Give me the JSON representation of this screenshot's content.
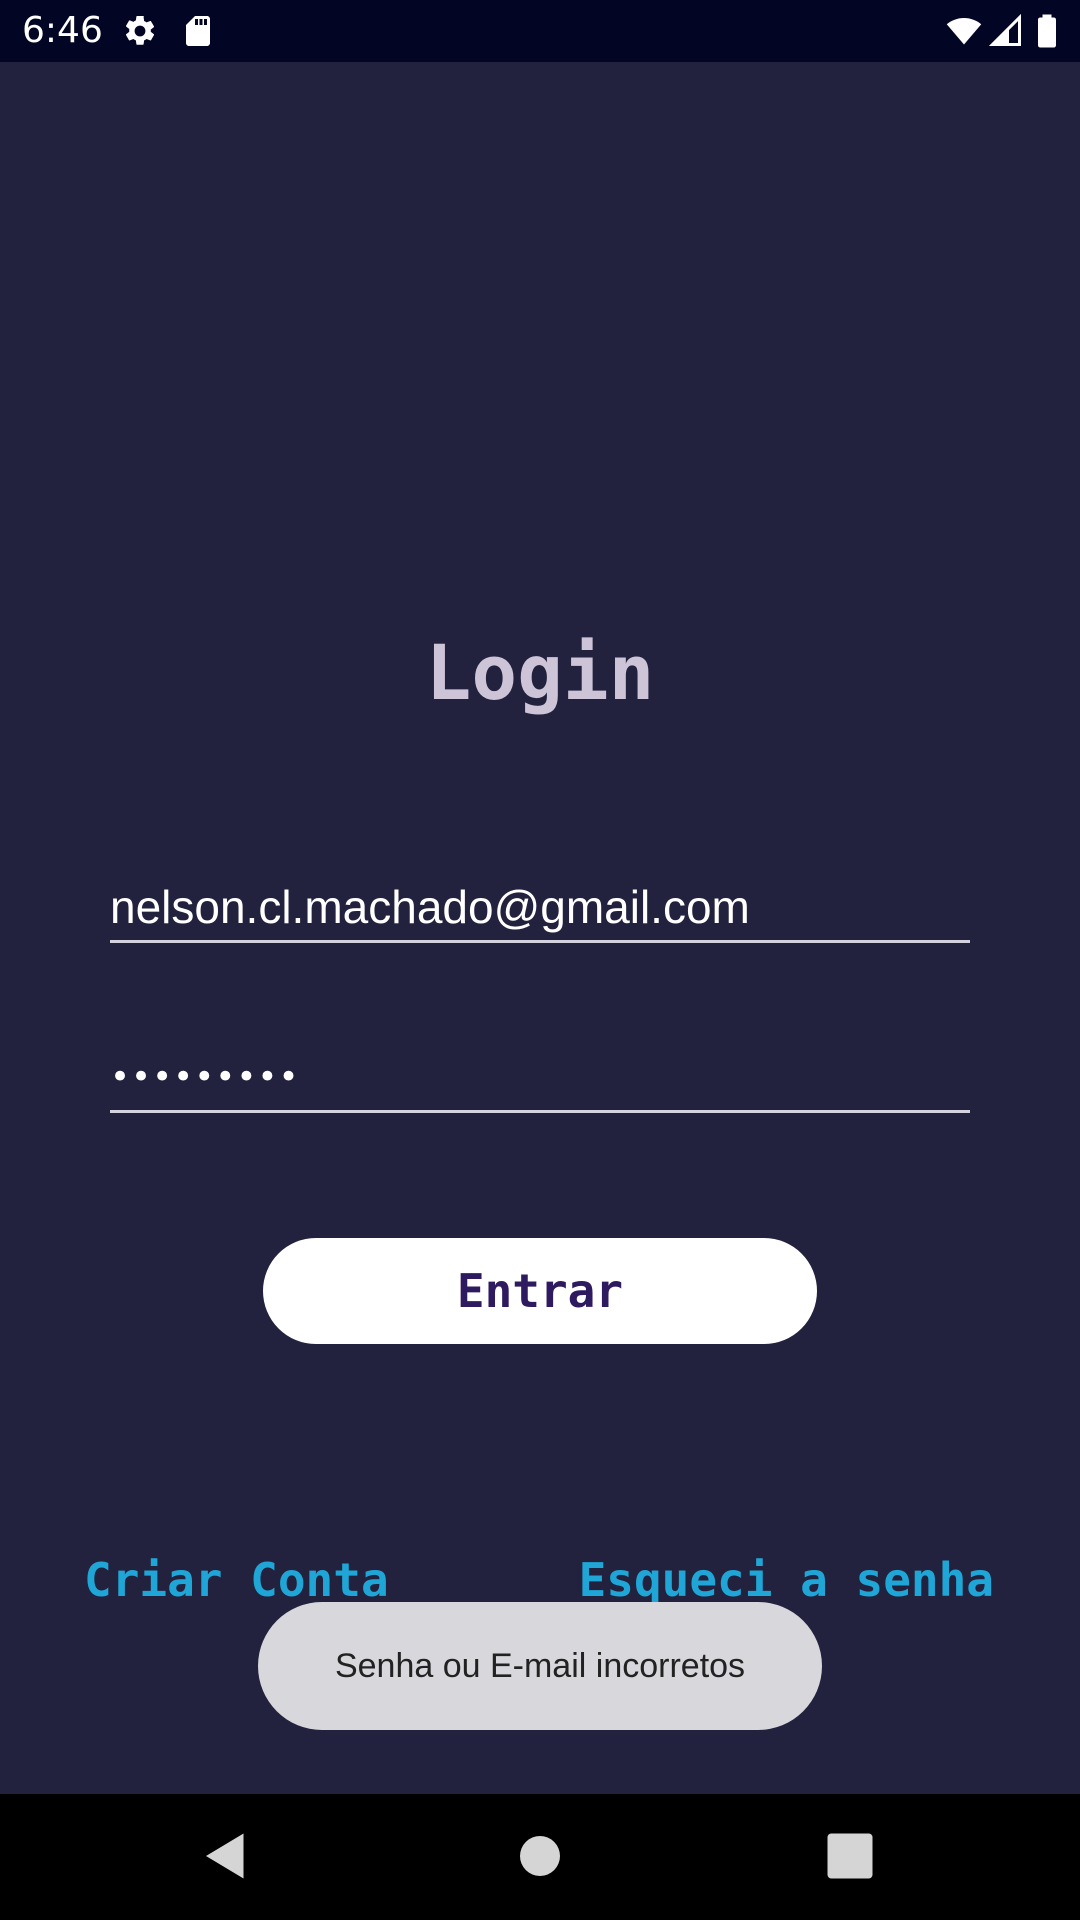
{
  "status_bar": {
    "time": "6:46",
    "icons": [
      "settings-gear-icon",
      "sd-card-icon",
      "wifi-icon",
      "cell-signal-icon",
      "battery-icon"
    ]
  },
  "login": {
    "title": "Login",
    "email_value": "nelson.cl.machado@gmail.com",
    "password_masked": "•••••••••",
    "submit_label": "Entrar"
  },
  "links": {
    "create_account": "Criar Conta",
    "forgot_password": "Esqueci a senha"
  },
  "toast": {
    "message": "Senha ou E-mail incorretos"
  },
  "colors": {
    "background": "#22223f",
    "status_bar": "#020523",
    "title": "#cec4d8",
    "button_text": "#2e1a5e",
    "link": "#1fa6d6",
    "toast_bg": "#d8d7dc"
  },
  "nav_bar": {
    "icons": [
      "back-triangle-icon",
      "home-circle-icon",
      "recents-square-icon"
    ]
  }
}
